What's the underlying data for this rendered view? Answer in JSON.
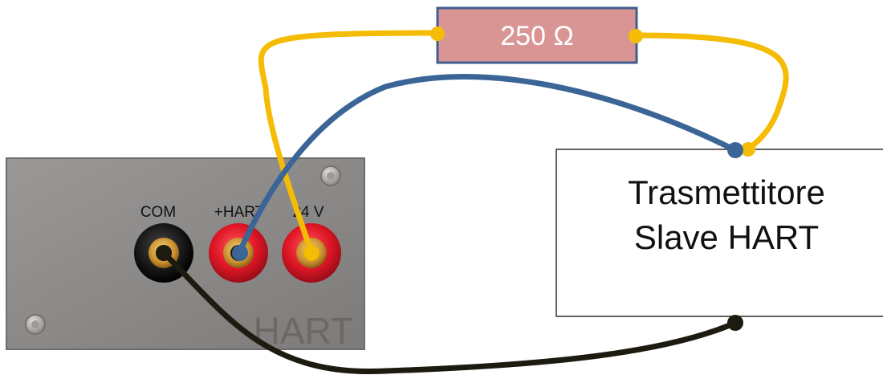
{
  "resistor": {
    "label": "250 Ω"
  },
  "panel": {
    "terminal_labels": {
      "com": "COM",
      "hart_plus": "+HART",
      "v24": "24 V"
    },
    "brand": "HART"
  },
  "transmitter": {
    "line1": "Trasmettitore",
    "line2": "Slave HART"
  },
  "colors": {
    "wire_yellow": "#F5BC06",
    "wire_blue": "#3A6596",
    "wire_black": "#1D1A10",
    "resistor_fill": "#D99594",
    "resistor_border": "#3E5E8F",
    "panel": "#8E8C8A",
    "jack_red": "#E01626",
    "jack_black": "#141414",
    "gold": "#D9A140"
  }
}
